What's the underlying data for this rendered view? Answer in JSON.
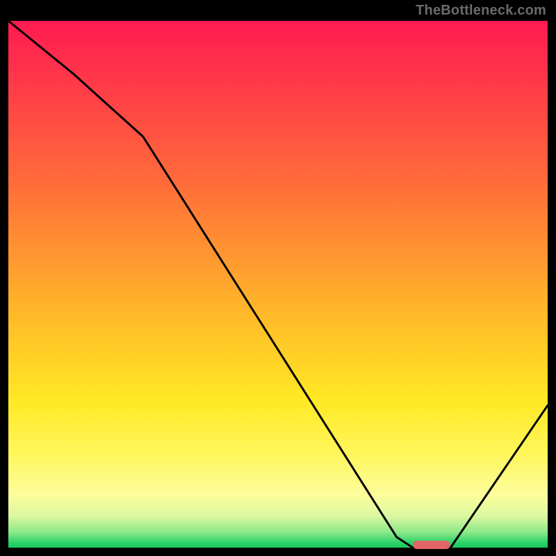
{
  "watermark": "TheBottleneck.com",
  "chart_data": {
    "type": "line",
    "title": "",
    "xlabel": "",
    "ylabel": "",
    "xlim": [
      0,
      100
    ],
    "ylim": [
      0,
      100
    ],
    "grid": false,
    "legend": false,
    "description": "Bottleneck curve over red-to-green gradient background. Curve reaches minimum (green zone) near x≈78.",
    "series": [
      {
        "name": "bottleneck-curve",
        "color": "#000000",
        "x": [
          0,
          12,
          25,
          72,
          75,
          82,
          100
        ],
        "values": [
          100,
          90,
          78,
          2,
          0,
          0,
          27
        ]
      }
    ],
    "marker": {
      "x_start": 75,
      "x_end": 82,
      "y": 0,
      "color": "#e06666"
    },
    "gradient_stops": [
      {
        "pos": 0,
        "color": "#ff1a52"
      },
      {
        "pos": 50,
        "color": "#ffb028"
      },
      {
        "pos": 85,
        "color": "#fff65a"
      },
      {
        "pos": 100,
        "color": "#17c95f"
      }
    ]
  }
}
